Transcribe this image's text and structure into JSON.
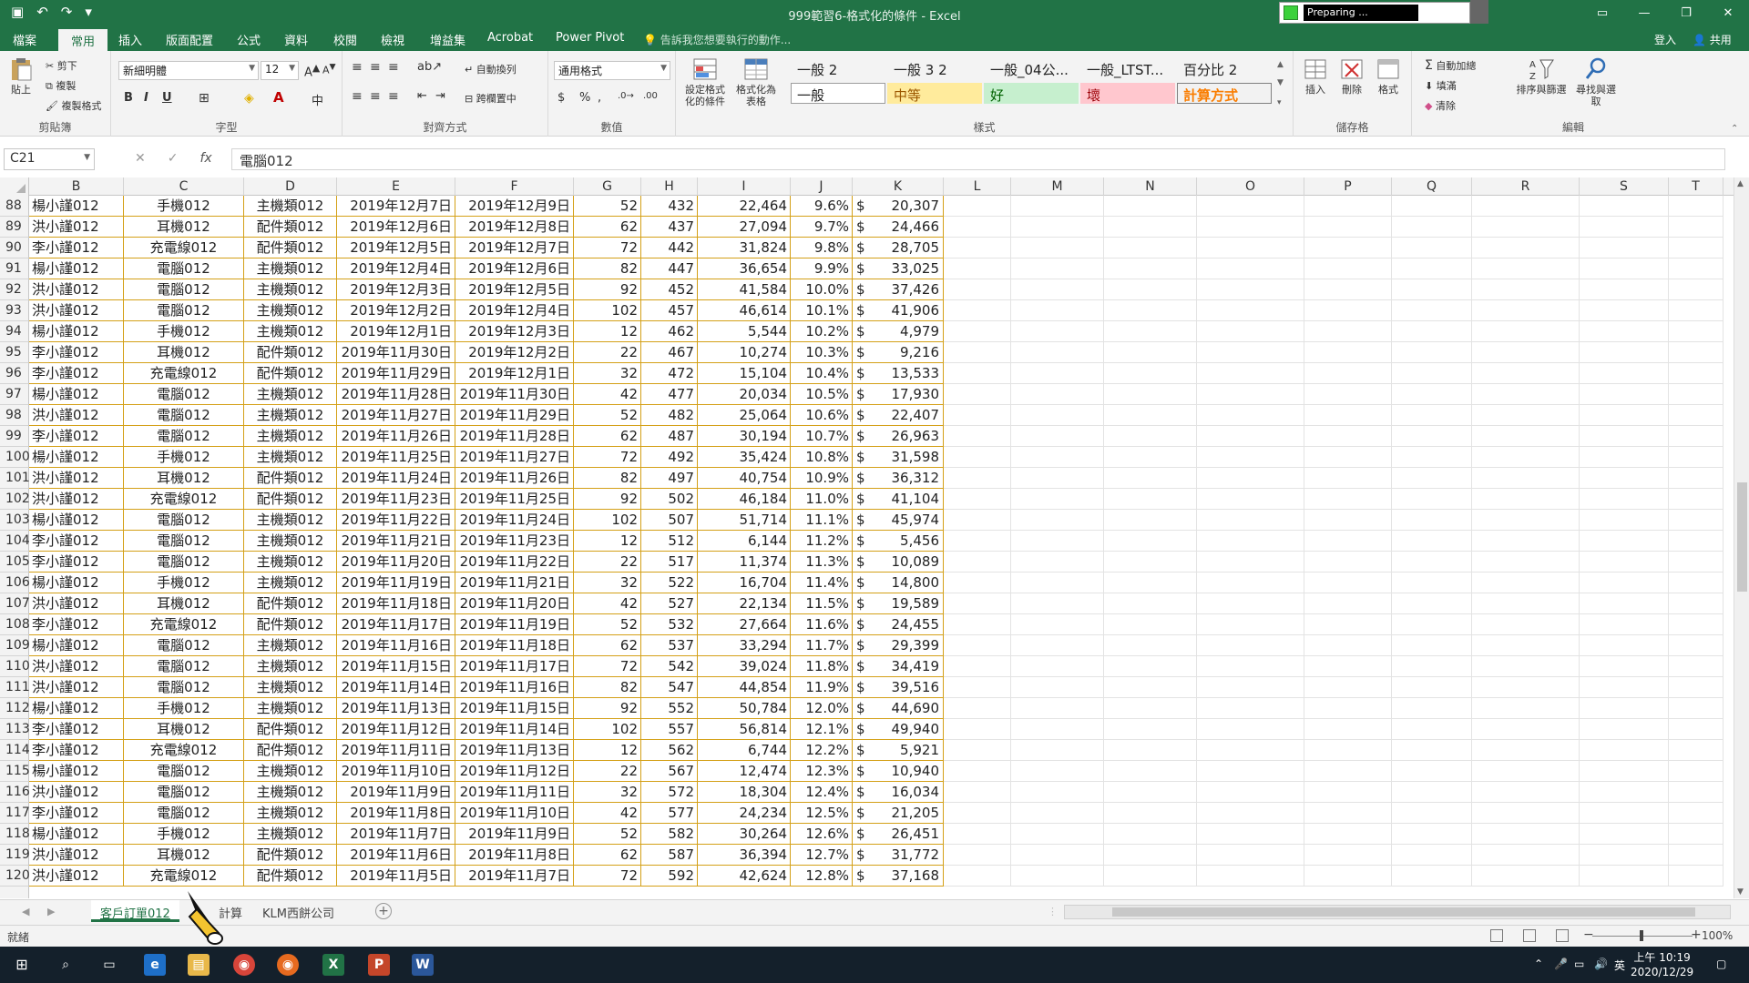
{
  "window": {
    "title": "999範習6-格式化的條件 - Excel",
    "preparing_text": "Preparing ...",
    "controls": [
      "▭",
      "—",
      "❐",
      "✕"
    ]
  },
  "tabs": [
    {
      "label": "檔案",
      "active": false
    },
    {
      "label": "常用",
      "active": true
    },
    {
      "label": "插入",
      "active": false
    },
    {
      "label": "版面配置",
      "active": false
    },
    {
      "label": "公式",
      "active": false
    },
    {
      "label": "資料",
      "active": false
    },
    {
      "label": "校閱",
      "active": false
    },
    {
      "label": "檢視",
      "active": false
    },
    {
      "label": "增益集",
      "active": false
    },
    {
      "label": "Acrobat",
      "active": false
    },
    {
      "label": "Power Pivot",
      "active": false
    }
  ],
  "tell_me": "告訴我您想要執行的動作...",
  "signin": "登入",
  "share": "共用",
  "ribbon": {
    "clipboard": {
      "paste": "貼上",
      "cut": "剪下",
      "copy": "複製",
      "format_painter": "複製格式",
      "label": "剪貼簿"
    },
    "font": {
      "name": "新細明體",
      "size": "12",
      "bold": "B",
      "italic": "I",
      "underline": "U",
      "label": "字型"
    },
    "alignment": {
      "wrap": "自動換列",
      "merge": "跨欄置中",
      "label": "對齊方式"
    },
    "number": {
      "format": "通用格式",
      "currency": "$",
      "percent": "%",
      "comma": ",",
      "label": "數值"
    },
    "styles": {
      "conditional": "設定格式化的條件",
      "as_table": "格式化為表格",
      "label": "樣式",
      "cells": [
        {
          "label": "一般 2",
          "bg": "#ffffff",
          "fg": "#000000"
        },
        {
          "label": "一般 3 2",
          "bg": "#ffffff",
          "fg": "#000000"
        },
        {
          "label": "一般_04公...",
          "bg": "#ffffff",
          "fg": "#000000"
        },
        {
          "label": "一般_LTST...",
          "bg": "#ffffff",
          "fg": "#000000"
        },
        {
          "label": "百分比 2",
          "bg": "#ffffff",
          "fg": "#000000"
        },
        {
          "label": "一般",
          "bg": "#ffffff",
          "fg": "#000000"
        },
        {
          "label": "中等",
          "bg": "#ffeb9c",
          "fg": "#9c5700"
        },
        {
          "label": "好",
          "bg": "#c6efce",
          "fg": "#006100"
        },
        {
          "label": "壞",
          "bg": "#ffc7ce",
          "fg": "#9c0006"
        },
        {
          "label": "計算方式",
          "bg": "#f2f2f2",
          "fg": "#fa7d00"
        }
      ]
    },
    "cells": {
      "insert": "插入",
      "delete": "刪除",
      "format": "格式",
      "label": "儲存格"
    },
    "editing": {
      "autosum": "自動加總",
      "fill": "填滿",
      "clear": "清除",
      "sort": "排序與篩選",
      "find": "尋找與選取",
      "label": "編輯"
    }
  },
  "formula_bar": {
    "name_box": "C21",
    "cancel": "✕",
    "enter": "✓",
    "fx": "fx",
    "formula": "電腦012"
  },
  "columns": [
    "B",
    "C",
    "D",
    "E",
    "F",
    "G",
    "H",
    "I",
    "J",
    "K",
    "L",
    "M",
    "N",
    "O",
    "P",
    "Q",
    "R",
    "S",
    "T"
  ],
  "rows": [
    {
      "n": "88",
      "b": "楊小謹012",
      "c": "手機012",
      "d": "主機類012",
      "e": "2019年12月7日",
      "f": "2019年12月9日",
      "g": "52",
      "h": "432",
      "i": "22,464",
      "j": "9.6%",
      "k": "20,307"
    },
    {
      "n": "89",
      "b": "洪小謹012",
      "c": "耳機012",
      "d": "配件類012",
      "e": "2019年12月6日",
      "f": "2019年12月8日",
      "g": "62",
      "h": "437",
      "i": "27,094",
      "j": "9.7%",
      "k": "24,466"
    },
    {
      "n": "90",
      "b": "李小謹012",
      "c": "充電線012",
      "d": "配件類012",
      "e": "2019年12月5日",
      "f": "2019年12月7日",
      "g": "72",
      "h": "442",
      "i": "31,824",
      "j": "9.8%",
      "k": "28,705"
    },
    {
      "n": "91",
      "b": "楊小謹012",
      "c": "電腦012",
      "d": "主機類012",
      "e": "2019年12月4日",
      "f": "2019年12月6日",
      "g": "82",
      "h": "447",
      "i": "36,654",
      "j": "9.9%",
      "k": "33,025"
    },
    {
      "n": "92",
      "b": "洪小謹012",
      "c": "電腦012",
      "d": "主機類012",
      "e": "2019年12月3日",
      "f": "2019年12月5日",
      "g": "92",
      "h": "452",
      "i": "41,584",
      "j": "10.0%",
      "k": "37,426"
    },
    {
      "n": "93",
      "b": "洪小謹012",
      "c": "電腦012",
      "d": "主機類012",
      "e": "2019年12月2日",
      "f": "2019年12月4日",
      "g": "102",
      "h": "457",
      "i": "46,614",
      "j": "10.1%",
      "k": "41,906"
    },
    {
      "n": "94",
      "b": "楊小謹012",
      "c": "手機012",
      "d": "主機類012",
      "e": "2019年12月1日",
      "f": "2019年12月3日",
      "g": "12",
      "h": "462",
      "i": "5,544",
      "j": "10.2%",
      "k": "4,979"
    },
    {
      "n": "95",
      "b": "李小謹012",
      "c": "耳機012",
      "d": "配件類012",
      "e": "2019年11月30日",
      "f": "2019年12月2日",
      "g": "22",
      "h": "467",
      "i": "10,274",
      "j": "10.3%",
      "k": "9,216"
    },
    {
      "n": "96",
      "b": "李小謹012",
      "c": "充電線012",
      "d": "配件類012",
      "e": "2019年11月29日",
      "f": "2019年12月1日",
      "g": "32",
      "h": "472",
      "i": "15,104",
      "j": "10.4%",
      "k": "13,533"
    },
    {
      "n": "97",
      "b": "楊小謹012",
      "c": "電腦012",
      "d": "主機類012",
      "e": "2019年11月28日",
      "f": "2019年11月30日",
      "g": "42",
      "h": "477",
      "i": "20,034",
      "j": "10.5%",
      "k": "17,930"
    },
    {
      "n": "98",
      "b": "洪小謹012",
      "c": "電腦012",
      "d": "主機類012",
      "e": "2019年11月27日",
      "f": "2019年11月29日",
      "g": "52",
      "h": "482",
      "i": "25,064",
      "j": "10.6%",
      "k": "22,407"
    },
    {
      "n": "99",
      "b": "李小謹012",
      "c": "電腦012",
      "d": "主機類012",
      "e": "2019年11月26日",
      "f": "2019年11月28日",
      "g": "62",
      "h": "487",
      "i": "30,194",
      "j": "10.7%",
      "k": "26,963"
    },
    {
      "n": "100",
      "b": "楊小謹012",
      "c": "手機012",
      "d": "主機類012",
      "e": "2019年11月25日",
      "f": "2019年11月27日",
      "g": "72",
      "h": "492",
      "i": "35,424",
      "j": "10.8%",
      "k": "31,598"
    },
    {
      "n": "101",
      "b": "洪小謹012",
      "c": "耳機012",
      "d": "配件類012",
      "e": "2019年11月24日",
      "f": "2019年11月26日",
      "g": "82",
      "h": "497",
      "i": "40,754",
      "j": "10.9%",
      "k": "36,312"
    },
    {
      "n": "102",
      "b": "洪小謹012",
      "c": "充電線012",
      "d": "配件類012",
      "e": "2019年11月23日",
      "f": "2019年11月25日",
      "g": "92",
      "h": "502",
      "i": "46,184",
      "j": "11.0%",
      "k": "41,104"
    },
    {
      "n": "103",
      "b": "楊小謹012",
      "c": "電腦012",
      "d": "主機類012",
      "e": "2019年11月22日",
      "f": "2019年11月24日",
      "g": "102",
      "h": "507",
      "i": "51,714",
      "j": "11.1%",
      "k": "45,974"
    },
    {
      "n": "104",
      "b": "李小謹012",
      "c": "電腦012",
      "d": "主機類012",
      "e": "2019年11月21日",
      "f": "2019年11月23日",
      "g": "12",
      "h": "512",
      "i": "6,144",
      "j": "11.2%",
      "k": "5,456"
    },
    {
      "n": "105",
      "b": "李小謹012",
      "c": "電腦012",
      "d": "主機類012",
      "e": "2019年11月20日",
      "f": "2019年11月22日",
      "g": "22",
      "h": "517",
      "i": "11,374",
      "j": "11.3%",
      "k": "10,089"
    },
    {
      "n": "106",
      "b": "楊小謹012",
      "c": "手機012",
      "d": "主機類012",
      "e": "2019年11月19日",
      "f": "2019年11月21日",
      "g": "32",
      "h": "522",
      "i": "16,704",
      "j": "11.4%",
      "k": "14,800"
    },
    {
      "n": "107",
      "b": "洪小謹012",
      "c": "耳機012",
      "d": "配件類012",
      "e": "2019年11月18日",
      "f": "2019年11月20日",
      "g": "42",
      "h": "527",
      "i": "22,134",
      "j": "11.5%",
      "k": "19,589"
    },
    {
      "n": "108",
      "b": "李小謹012",
      "c": "充電線012",
      "d": "配件類012",
      "e": "2019年11月17日",
      "f": "2019年11月19日",
      "g": "52",
      "h": "532",
      "i": "27,664",
      "j": "11.6%",
      "k": "24,455"
    },
    {
      "n": "109",
      "b": "楊小謹012",
      "c": "電腦012",
      "d": "主機類012",
      "e": "2019年11月16日",
      "f": "2019年11月18日",
      "g": "62",
      "h": "537",
      "i": "33,294",
      "j": "11.7%",
      "k": "29,399"
    },
    {
      "n": "110",
      "b": "洪小謹012",
      "c": "電腦012",
      "d": "主機類012",
      "e": "2019年11月15日",
      "f": "2019年11月17日",
      "g": "72",
      "h": "542",
      "i": "39,024",
      "j": "11.8%",
      "k": "34,419"
    },
    {
      "n": "111",
      "b": "洪小謹012",
      "c": "電腦012",
      "d": "主機類012",
      "e": "2019年11月14日",
      "f": "2019年11月16日",
      "g": "82",
      "h": "547",
      "i": "44,854",
      "j": "11.9%",
      "k": "39,516"
    },
    {
      "n": "112",
      "b": "楊小謹012",
      "c": "手機012",
      "d": "主機類012",
      "e": "2019年11月13日",
      "f": "2019年11月15日",
      "g": "92",
      "h": "552",
      "i": "50,784",
      "j": "12.0%",
      "k": "44,690"
    },
    {
      "n": "113",
      "b": "李小謹012",
      "c": "耳機012",
      "d": "配件類012",
      "e": "2019年11月12日",
      "f": "2019年11月14日",
      "g": "102",
      "h": "557",
      "i": "56,814",
      "j": "12.1%",
      "k": "49,940"
    },
    {
      "n": "114",
      "b": "李小謹012",
      "c": "充電線012",
      "d": "配件類012",
      "e": "2019年11月11日",
      "f": "2019年11月13日",
      "g": "12",
      "h": "562",
      "i": "6,744",
      "j": "12.2%",
      "k": "5,921"
    },
    {
      "n": "115",
      "b": "楊小謹012",
      "c": "電腦012",
      "d": "主機類012",
      "e": "2019年11月10日",
      "f": "2019年11月12日",
      "g": "22",
      "h": "567",
      "i": "12,474",
      "j": "12.3%",
      "k": "10,940"
    },
    {
      "n": "116",
      "b": "洪小謹012",
      "c": "電腦012",
      "d": "主機類012",
      "e": "2019年11月9日",
      "f": "2019年11月11日",
      "g": "32",
      "h": "572",
      "i": "18,304",
      "j": "12.4%",
      "k": "16,034"
    },
    {
      "n": "117",
      "b": "李小謹012",
      "c": "電腦012",
      "d": "主機類012",
      "e": "2019年11月8日",
      "f": "2019年11月10日",
      "g": "42",
      "h": "577",
      "i": "24,234",
      "j": "12.5%",
      "k": "21,205"
    },
    {
      "n": "118",
      "b": "楊小謹012",
      "c": "手機012",
      "d": "主機類012",
      "e": "2019年11月7日",
      "f": "2019年11月9日",
      "g": "52",
      "h": "582",
      "i": "30,264",
      "j": "12.6%",
      "k": "26,451"
    },
    {
      "n": "119",
      "b": "洪小謹012",
      "c": "耳機012",
      "d": "配件類012",
      "e": "2019年11月6日",
      "f": "2019年11月8日",
      "g": "62",
      "h": "587",
      "i": "36,394",
      "j": "12.7%",
      "k": "31,772"
    },
    {
      "n": "120",
      "b": "洪小謹012",
      "c": "充電線012",
      "d": "配件類012",
      "e": "2019年11月5日",
      "f": "2019年11月7日",
      "g": "72",
      "h": "592",
      "i": "42,624",
      "j": "12.8%",
      "k": "37,168"
    }
  ],
  "sheet_tabs": [
    {
      "label": "客戶訂單012",
      "active": true
    },
    {
      "label": "計算",
      "active": false
    },
    {
      "label": "KLM西餅公司",
      "active": false
    }
  ],
  "status": {
    "ready": "就緒",
    "zoom": "100%"
  },
  "taskbar": {
    "time": "上午 10:19",
    "date": "2020/12/29",
    "ime": "英"
  },
  "colors": {
    "excel_green": "#217346",
    "table_border": "#d4a017"
  }
}
